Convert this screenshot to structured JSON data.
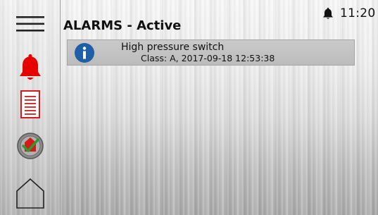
{
  "header": {
    "time": "11:20",
    "title": "ALARMS - Active"
  },
  "sidebar": {
    "items": [
      {
        "icon": "menu-icon"
      },
      {
        "icon": "alarm-bell-icon",
        "color": "#e60000"
      },
      {
        "icon": "document-list-icon",
        "color": "#d61a1a"
      },
      {
        "icon": "checkmark-badge-icon"
      },
      {
        "icon": "home-icon"
      }
    ]
  },
  "alarms": [
    {
      "icon": "info-icon",
      "message": "High pressure switch",
      "detail": "Class: A, 2017-09-18 12:53:38"
    }
  ],
  "colors": {
    "alarm_red": "#e60000",
    "info_blue": "#1f5fa8"
  }
}
